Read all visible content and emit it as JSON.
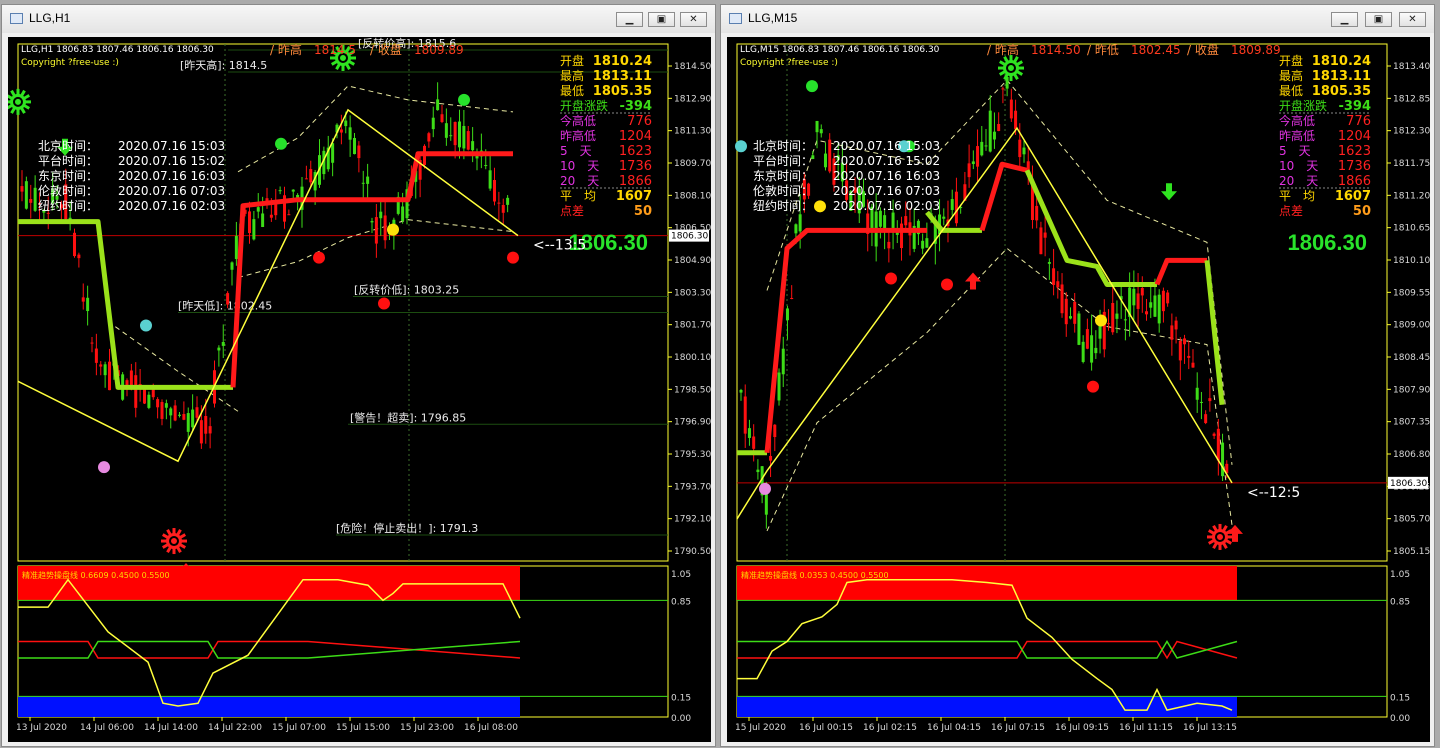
{
  "windows": [
    {
      "title": "LLG,H1",
      "header": "LLG,H1  1806.83 1807.46 1806.16 1806.30",
      "copyright": "Copyright ?free-use :)",
      "top_stats": [
        "/ 昨高",
        "1814.5",
        "/ 收盘",
        "1809.89"
      ],
      "panel": [
        [
          "开盘",
          "1810.24"
        ],
        [
          "最高",
          "1813.11"
        ],
        [
          "最低",
          "1805.35"
        ],
        [
          "开盘涨跌",
          "-394"
        ],
        [
          "今高低",
          "776"
        ],
        [
          "昨高低",
          "1204"
        ],
        [
          "5　天",
          "1623"
        ],
        [
          "10　天",
          "1736"
        ],
        [
          "20　天",
          "1866"
        ],
        [
          "平　均",
          "1607"
        ],
        [
          "点差",
          "50"
        ]
      ],
      "big_price": "1806.30",
      "arrow_label": "<--13:5",
      "times": [
        [
          "北京时间：",
          "2020.07.16 15:03"
        ],
        [
          "平台时间：",
          "2020.07.16 15:02"
        ],
        [
          "东京时间：",
          "2020.07.16 16:03"
        ],
        [
          "伦敦时间：",
          "2020.07.16 07:03"
        ],
        [
          "纽约时间：",
          "2020.07.16 02:03"
        ]
      ],
      "levels": [
        {
          "label": "[昨天高]: 1814.5",
          "price": 1814.5
        },
        {
          "label": "[反转价高]: 1815.6",
          "price": 1815.6
        },
        {
          "label": "[昨天低]: 1802.45",
          "price": 1802.45
        },
        {
          "label": "[反转价低]: 1803.25",
          "price": 1803.25
        },
        {
          "label": "[警告！超卖]: 1796.85",
          "price": 1796.85
        },
        {
          "label": "[危险！停止卖出！]: 1791.3",
          "price": 1791.3
        }
      ],
      "price_axis": [
        "1814.50",
        "1812.90",
        "1811.30",
        "1809.70",
        "1808.10",
        "1806.50",
        "1804.90",
        "1803.30",
        "1801.70",
        "1800.10",
        "1798.50",
        "1796.90",
        "1795.30",
        "1793.70",
        "1792.10",
        "1790.50"
      ],
      "current_price_label": "1806.30",
      "y_range": [
        1790.0,
        1815.9
      ],
      "indicator_title": "精准趋势操盘线 0.6609 0.4500 0.5500",
      "indicator_axis": [
        "1.05",
        "0.85",
        "0.15",
        "0.00"
      ],
      "time_axis": [
        "13 Jul 2020",
        "14 Jul 06:00",
        "14 Jul 14:00",
        "14 Jul 22:00",
        "15 Jul 07:00",
        "15 Jul 15:00",
        "15 Jul 23:00",
        "16 Jul 08:00"
      ]
    },
    {
      "title": "LLG,M15",
      "header": "LLG,M15  1806.83 1807.46 1806.16 1806.30",
      "copyright": "Copyright ?free-use :)",
      "top_stats": [
        "/ 昨高",
        "1814.50",
        "/ 昨低",
        "1802.45",
        "/ 收盘",
        "1809.89"
      ],
      "panel": [
        [
          "开盘",
          "1810.24"
        ],
        [
          "最高",
          "1813.11"
        ],
        [
          "最低",
          "1805.35"
        ],
        [
          "开盘涨跌",
          "-394"
        ],
        [
          "今高低",
          "776"
        ],
        [
          "昨高低",
          "1204"
        ],
        [
          "5　天",
          "1623"
        ],
        [
          "10　天",
          "1736"
        ],
        [
          "20　天",
          "1866"
        ],
        [
          "平　均",
          "1607"
        ],
        [
          "点差",
          "50"
        ]
      ],
      "big_price": "1806.30",
      "arrow_label": "<--12:5",
      "times": [
        [
          "北京时间：",
          "2020.07.16 15:03"
        ],
        [
          "平台时间：",
          "2020.07.16 15:02"
        ],
        [
          "东京时间：",
          "2020.07.16 16:03"
        ],
        [
          "伦敦时间：",
          "2020.07.16 07:03"
        ],
        [
          "纽约时间：",
          "2020.07.16 02:03"
        ]
      ],
      "price_axis": [
        "1813.40",
        "1812.85",
        "1812.30",
        "1811.75",
        "1811.20",
        "1810.65",
        "1810.10",
        "1809.55",
        "1809.00",
        "1808.45",
        "1807.90",
        "1807.35",
        "1806.80",
        "1806.25",
        "1805.70",
        "1805.15"
      ],
      "current_price_label": "1806.30",
      "y_range": [
        1805.0,
        1813.6
      ],
      "indicator_title": "精准趋势操盘线 0.0353 0.4500 0.5500",
      "indicator_axis": [
        "1.05",
        "0.85",
        "0.15",
        "0.00"
      ],
      "time_axis": [
        "15 Jul 2020",
        "16 Jul 00:15",
        "16 Jul 02:15",
        "16 Jul 04:15",
        "16 Jul 07:15",
        "16 Jul 09:15",
        "16 Jul 11:15",
        "16 Jul 13:15"
      ]
    }
  ],
  "colors": {
    "bull": "#3ddc17",
    "bear": "#ff1010",
    "trend_red": "#ff1a1a",
    "trend_green": "#9be21a",
    "zigzag": "#ffff3c",
    "axis": "#ffff30",
    "panel_label": "#ffd700",
    "magenta": "#e033e0",
    "price_big": "#29e32b"
  },
  "icons": [
    "window-icon",
    "minimize-icon",
    "maximize-icon",
    "close-icon",
    "sun-signal-icon",
    "arrow-up-icon",
    "arrow-down-icon"
  ]
}
